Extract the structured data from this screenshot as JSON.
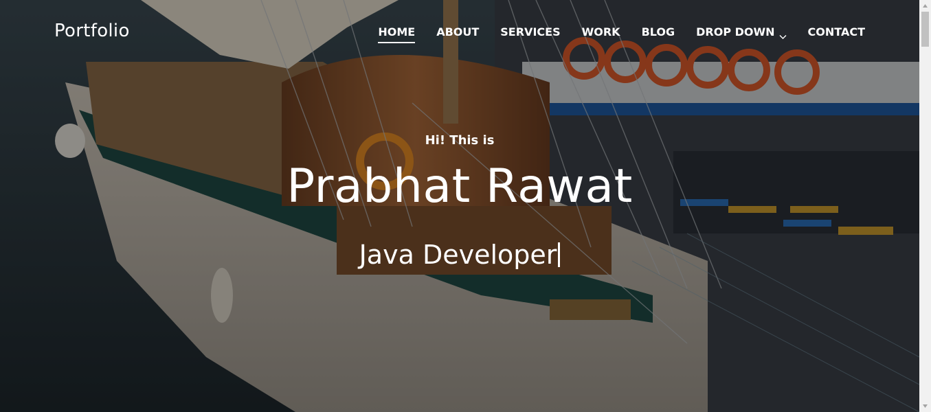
{
  "brand": "Portfolio",
  "nav": {
    "items": [
      {
        "label": "HOME",
        "active": true
      },
      {
        "label": "ABOUT"
      },
      {
        "label": "SERVICES"
      },
      {
        "label": "WORK"
      },
      {
        "label": "BLOG"
      },
      {
        "label": "DROP DOWN",
        "has_dropdown": true
      },
      {
        "label": "CONTACT"
      }
    ]
  },
  "hero": {
    "greeting": "Hi! This is",
    "name": "Prabhat Rawat",
    "role": "Java Developer"
  },
  "colors": {
    "text": "#ffffff",
    "overlay": "rgba(0,0,0,0.38)",
    "scrollbar_track": "#f1f1f1",
    "scrollbar_thumb": "#c1c1c1"
  }
}
